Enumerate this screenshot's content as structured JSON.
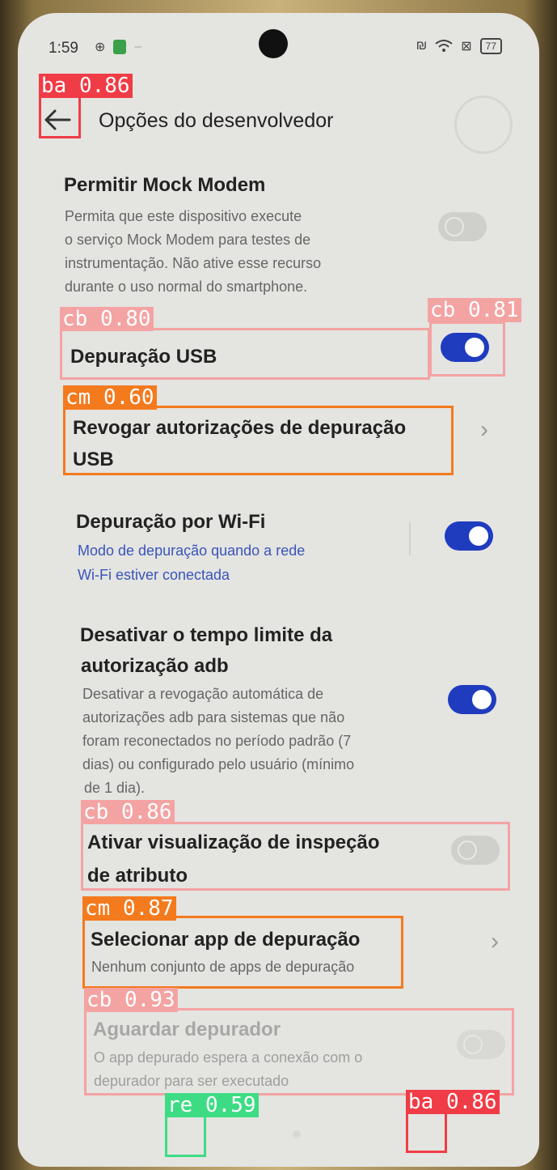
{
  "status_bar": {
    "time": "1:59",
    "battery": "77"
  },
  "header": {
    "title": "Opções do desenvolvedor"
  },
  "settings": {
    "mock_modem": {
      "title": "Permitir Mock Modem",
      "desc_lines": [
        "Permita que este dispositivo execute",
        "o serviço Mock Modem para testes de",
        "instrumentação. Não ative esse recurso",
        "durante o uso normal do smartphone."
      ],
      "enabled": false
    },
    "usb_debugging": {
      "title": "Depuração USB",
      "enabled": true
    },
    "revoke_usb": {
      "title_lines": [
        "Revogar autorizações de depuração",
        "USB"
      ]
    },
    "wifi_debugging": {
      "title": "Depuração por Wi-Fi",
      "desc_lines": [
        "Modo de depuração quando a rede",
        "Wi-Fi estiver conectada"
      ],
      "enabled": true
    },
    "adb_timeout": {
      "title_lines": [
        "Desativar o tempo limite da",
        "autorização adb"
      ],
      "desc_lines": [
        "Desativar a revogação automática de",
        "autorizações adb para sistemas que não",
        "foram reconectados no período padrão (7",
        "dias) ou configurado pelo usuário (mínimo",
        "de 1 dia)."
      ],
      "enabled": true
    },
    "attribute_inspection": {
      "title_lines": [
        "Ativar visualização de inspeção",
        "de atributo"
      ],
      "enabled": false
    },
    "debug_app": {
      "title": "Selecionar app de depuração",
      "desc": "Nenhum conjunto de apps de depuração"
    },
    "wait_debugger": {
      "title": "Aguardar depurador",
      "desc_lines": [
        "O app depurado espera a conexão com o",
        "depurador para ser executado"
      ],
      "enabled": false
    }
  },
  "detections": [
    {
      "label": "ba 0.86",
      "color": "#f03c46"
    },
    {
      "label": "cb 0.80",
      "color": "#f4a3a3"
    },
    {
      "label": "cb 0.81",
      "color": "#f4a3a3"
    },
    {
      "label": "cm 0.60",
      "color": "#f47a1e"
    },
    {
      "label": "cb 0.86",
      "color": "#f4a3a3"
    },
    {
      "label": "cm 0.87",
      "color": "#f47a1e"
    },
    {
      "label": "cb 0.93",
      "color": "#f4a3a3"
    },
    {
      "label": "re 0.59",
      "color": "#3ddc84"
    },
    {
      "label": "ba 0.86",
      "color": "#f03c46"
    }
  ]
}
